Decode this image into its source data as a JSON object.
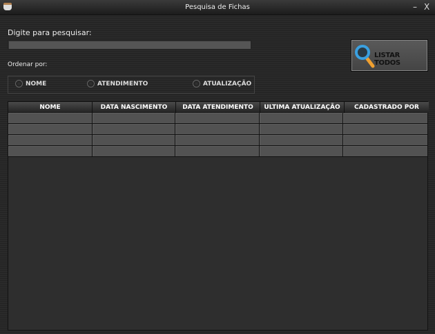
{
  "window": {
    "title": "Pesquisa de Fichas",
    "minimize": "–",
    "close": "X"
  },
  "search": {
    "label": "Digite para pesquisar:",
    "value": "",
    "placeholder": ""
  },
  "list_button": {
    "label": "LISTAR TODOS",
    "icon": "magnifier-icon"
  },
  "sort": {
    "label": "Ordenar por:",
    "options": [
      "NOME",
      "ATENDIMENTO",
      "ATUALIZAÇÃO"
    ],
    "selected": null
  },
  "table": {
    "columns": [
      "NOME",
      "DATA NASCIMENTO",
      "DATA ATENDIMENTO",
      "ULTIMA ATUALIZAÇÃO",
      "CADASTRADO POR"
    ],
    "rows": [
      [
        "",
        "",
        "",
        "",
        ""
      ],
      [
        "",
        "",
        "",
        "",
        ""
      ],
      [
        "",
        "",
        "",
        "",
        ""
      ],
      [
        "",
        "",
        "",
        "",
        ""
      ]
    ]
  },
  "colors": {
    "background": "#2a2a2a",
    "accent_icon": "#3aa0e0",
    "icon_handle": "#f0a030"
  }
}
